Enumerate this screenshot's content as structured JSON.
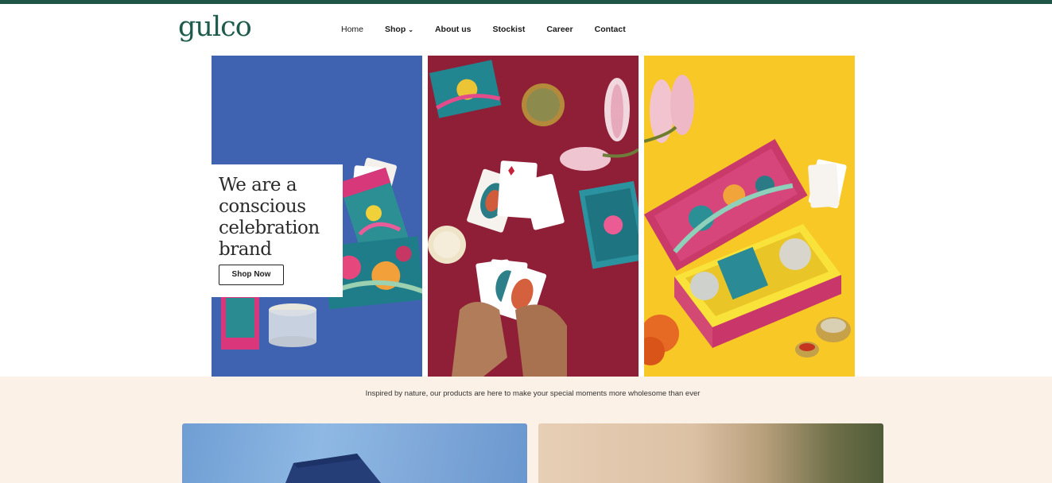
{
  "brand": {
    "logo_text": "gulco",
    "accent": "#1e5546"
  },
  "nav": {
    "items": [
      {
        "label": "Home"
      },
      {
        "label": "Shop",
        "has_dropdown": true
      },
      {
        "label": "About us"
      },
      {
        "label": "Stockist"
      },
      {
        "label": "Career"
      },
      {
        "label": "Contact"
      }
    ]
  },
  "hero": {
    "title": "We are a conscious celebration brand",
    "button_label": "Shop Now",
    "panel_colors": [
      "#3f63b1",
      "#8e1f36",
      "#f7c826"
    ]
  },
  "tagline": "Inspired by nature, our products are here to make your special moments more wholesome than ever",
  "section_band_color": "#fbf1e6"
}
